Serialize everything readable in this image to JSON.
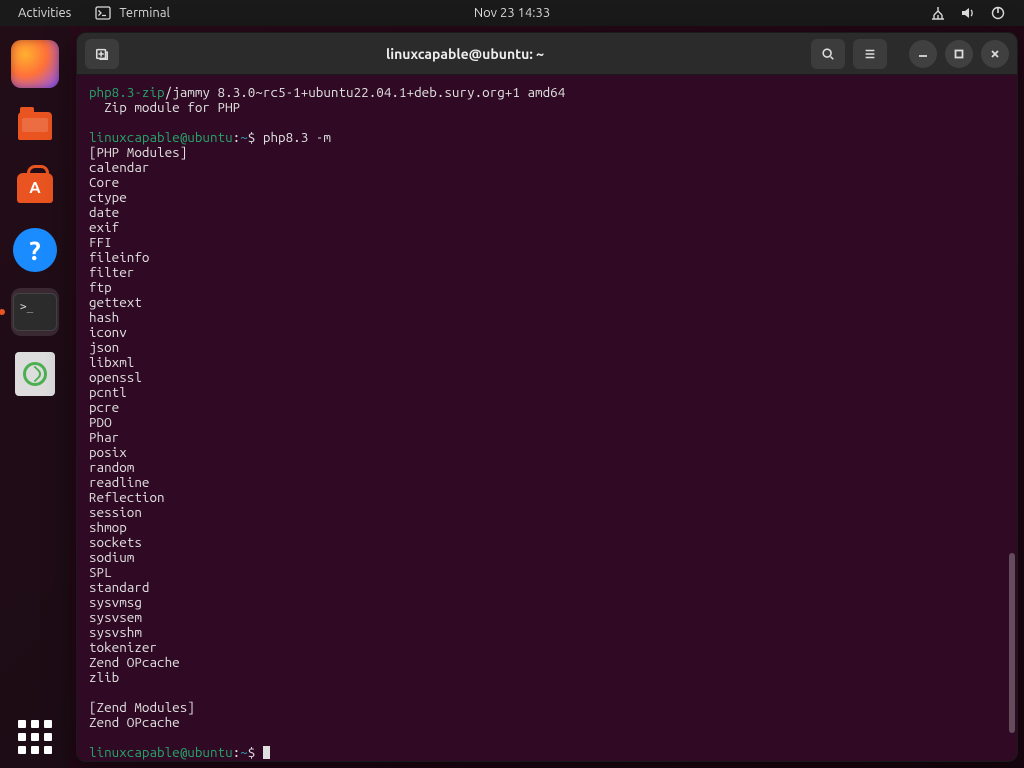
{
  "topbar": {
    "activities": "Activities",
    "app_label": "Terminal",
    "datetime": "Nov 23  14:33"
  },
  "tooltip": {
    "text": "Terminal"
  },
  "window": {
    "title": "linuxcapable@ubuntu: ~"
  },
  "term": {
    "pkg_name": "php8.3-zip",
    "pkg_rest": "/jammy 8.3.0~rc5-1+ubuntu22.04.1+deb.sury.org+1 amd64",
    "pkg_desc": "  Zip module for PHP",
    "prompt_user": "linuxcapable@ubuntu",
    "prompt_sep": ":",
    "prompt_path": "~",
    "prompt_sym": "$ ",
    "cmd1": "php8.3 -m",
    "header1": "[PHP Modules]",
    "modules": [
      "calendar",
      "Core",
      "ctype",
      "date",
      "exif",
      "FFI",
      "fileinfo",
      "filter",
      "ftp",
      "gettext",
      "hash",
      "iconv",
      "json",
      "libxml",
      "openssl",
      "pcntl",
      "pcre",
      "PDO",
      "Phar",
      "posix",
      "random",
      "readline",
      "Reflection",
      "session",
      "shmop",
      "sockets",
      "sodium",
      "SPL",
      "standard",
      "sysvmsg",
      "sysvsem",
      "sysvshm",
      "tokenizer",
      "Zend OPcache",
      "zlib"
    ],
    "header2": "[Zend Modules]",
    "zend_modules": [
      "Zend OPcache"
    ]
  }
}
